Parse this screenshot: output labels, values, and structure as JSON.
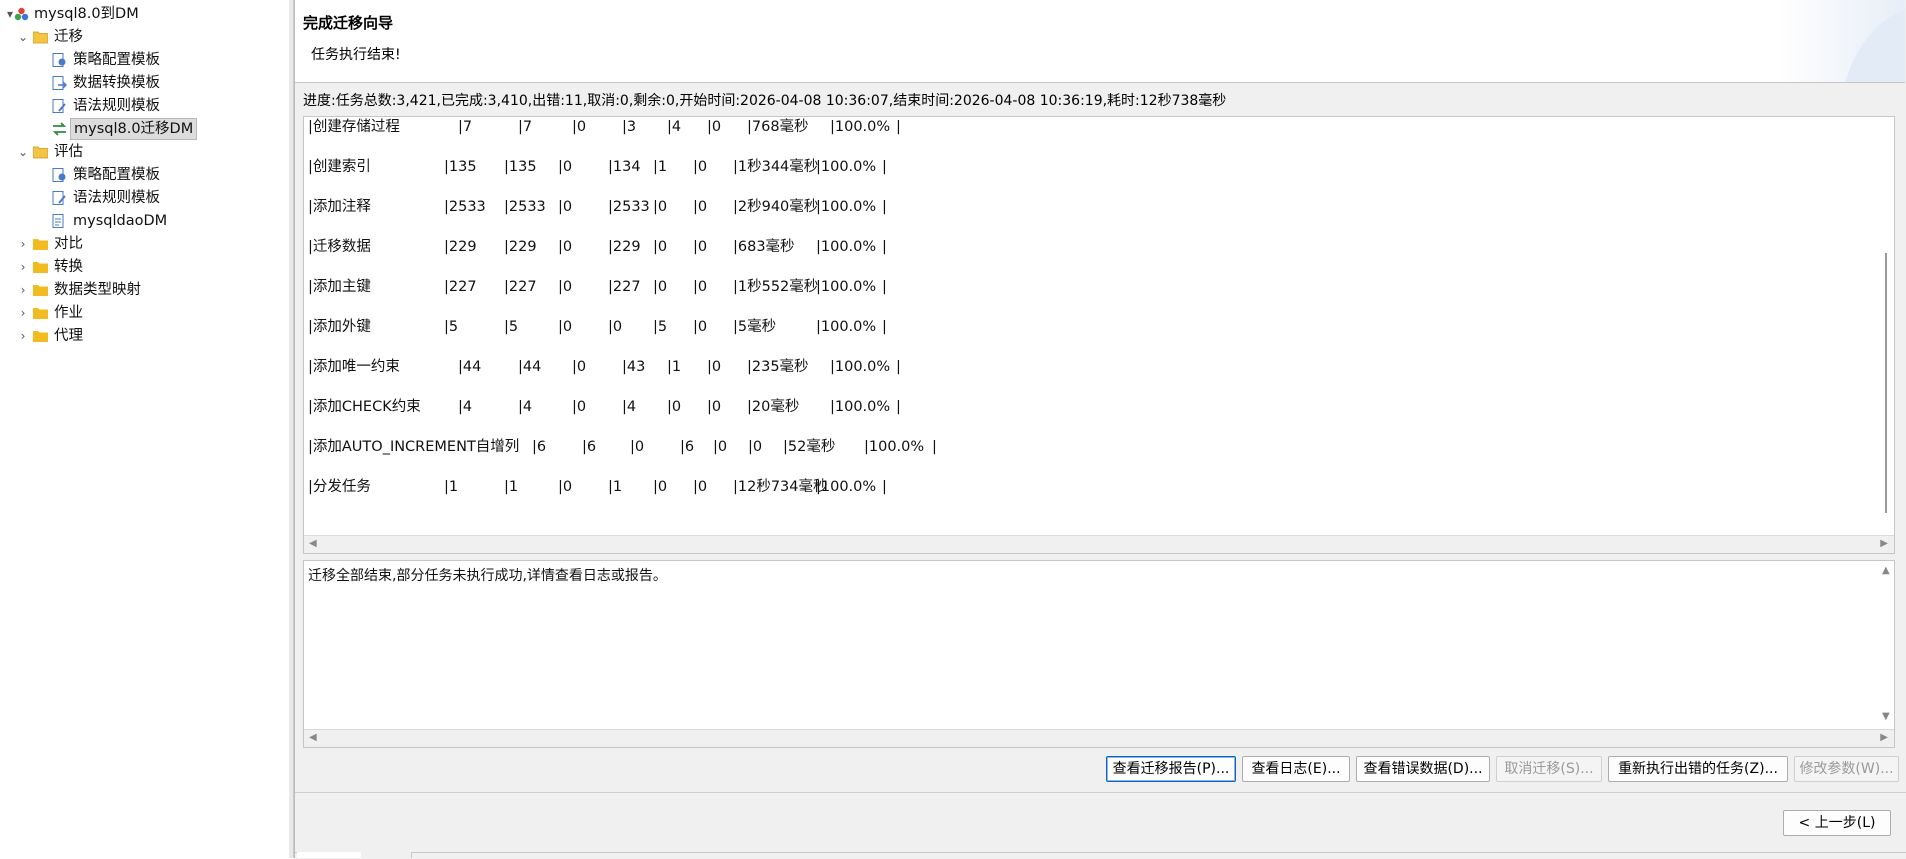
{
  "tree": {
    "root": {
      "label": "mysql8.0到DM",
      "icon": "project-icon"
    },
    "migrate": {
      "label": "迁移",
      "children": [
        {
          "label": "策略配置模板",
          "icon": "strategy-template-icon"
        },
        {
          "label": "数据转换模板",
          "icon": "data-convert-template-icon"
        },
        {
          "label": "语法规则模板",
          "icon": "syntax-rule-template-icon"
        },
        {
          "label": "mysql8.0迁移DM",
          "icon": "migration-task-icon",
          "selected": true
        }
      ]
    },
    "evaluate": {
      "label": "评估",
      "children": [
        {
          "label": "策略配置模板",
          "icon": "strategy-template-icon"
        },
        {
          "label": "语法规则模板",
          "icon": "syntax-rule-template-icon"
        },
        {
          "label": "mysqldaoDM",
          "icon": "evaluation-task-icon"
        }
      ]
    },
    "others": [
      "对比",
      "转换",
      "数据类型映射",
      "作业",
      "代理"
    ]
  },
  "wizard": {
    "title": "完成迁移向导",
    "subtitle": "任务执行结束!",
    "progress": "进度:任务总数:3,421,已完成:3,410,出错:11,取消:0,剩余:0,开始时间:2026-04-08 10:36:07,结束时间:2026-04-08 10:36:19,耗时:12秒738毫秒"
  },
  "task_rows": [
    {
      "name": "|创建存储过程",
      "c1": "|7",
      "c2": "|7",
      "c3": "|0",
      "c4": "|3",
      "c5": "|4",
      "c6": "|0",
      "time": "|768毫秒",
      "pct": "|100.0%",
      "end": "|"
    },
    {
      "name": "|创建索引",
      "c1": "|135",
      "c2": "|135",
      "c3": "|0",
      "c4": "|134",
      "c5": "|1",
      "c6": "|0",
      "time": "|1秒344毫秒",
      "pct": "|100.0%",
      "end": "|"
    },
    {
      "name": "|添加注释",
      "c1": "|2533",
      "c2": "|2533",
      "c3": "|0",
      "c4": "|2533",
      "c5": "|0",
      "c6": "|0",
      "time": "|2秒940毫秒",
      "pct": "|100.0%",
      "end": "|"
    },
    {
      "name": "|迁移数据",
      "c1": "|229",
      "c2": "|229",
      "c3": "|0",
      "c4": "|229",
      "c5": "|0",
      "c6": "|0",
      "time": "|683毫秒",
      "pct": "|100.0%",
      "end": "|"
    },
    {
      "name": "|添加主键",
      "c1": "|227",
      "c2": "|227",
      "c3": "|0",
      "c4": "|227",
      "c5": "|0",
      "c6": "|0",
      "time": "|1秒552毫秒",
      "pct": "|100.0%",
      "end": "|"
    },
    {
      "name": "|添加外键",
      "c1": "|5",
      "c2": "|5",
      "c3": "|0",
      "c4": "|0",
      "c5": "|5",
      "c6": "|0",
      "time": "|5毫秒",
      "pct": "|100.0%",
      "end": "|"
    },
    {
      "name": "|添加唯一约束",
      "c1": "|44",
      "c2": "|44",
      "c3": "|0",
      "c4": "|43",
      "c5": "|1",
      "c6": "|0",
      "time": "|235毫秒",
      "pct": "|100.0%",
      "end": "|"
    },
    {
      "name": "|添加CHECK约束",
      "c1": "|4",
      "c2": "|4",
      "c3": "|0",
      "c4": "|4",
      "c5": "|0",
      "c6": "|0",
      "time": "|20毫秒",
      "pct": "|100.0%",
      "end": "|"
    },
    {
      "name": "|添加AUTO_INCREMENT自增列",
      "c1": "|6",
      "c2": "|6",
      "c3": "|0",
      "c4": "|6",
      "c5": "|0",
      "c6": "|0",
      "time": "|52毫秒",
      "pct": "|100.0%",
      "end": "|"
    },
    {
      "name": "|分发任务",
      "c1": "|1",
      "c2": "|1",
      "c3": "|0",
      "c4": "|1",
      "c5": "|0",
      "c6": "|0",
      "time": "|12秒734毫秒",
      "pct": "|100.0%",
      "end": "|"
    }
  ],
  "message": "迁移全部结束,部分任务未执行成功,详情查看日志或报告。",
  "buttons": {
    "view_report": "查看迁移报告(P)...",
    "view_log": "查看日志(E)...",
    "view_error_data": "查看错误数据(D)...",
    "cancel_migration": "取消迁移(S)...",
    "rerun_failed": "重新执行出错的任务(Z)...",
    "modify_params": "修改参数(W)...",
    "back": "< 上一步(L)"
  }
}
